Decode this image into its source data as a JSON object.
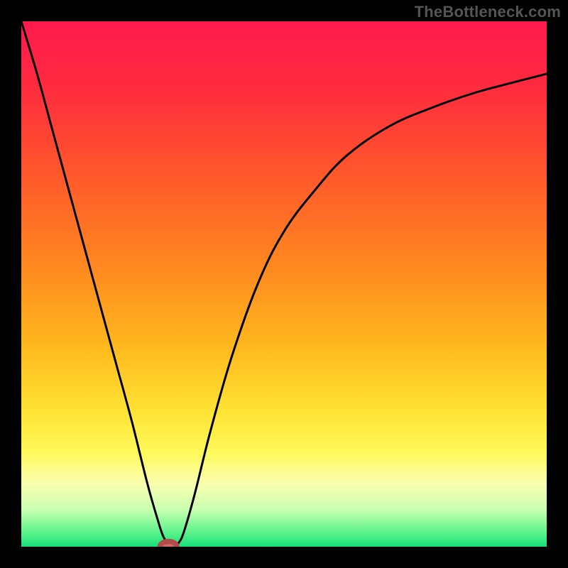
{
  "watermark": "TheBottleneck.com",
  "colors": {
    "black": "#000000",
    "curve": "#000000",
    "marker_fill": "#d46a6a",
    "marker_stroke": "#b24c4c",
    "gradient_stops": [
      {
        "offset": 0.0,
        "color": "#ff1a4d"
      },
      {
        "offset": 0.12,
        "color": "#ff2a3f"
      },
      {
        "offset": 0.3,
        "color": "#ff5a2a"
      },
      {
        "offset": 0.48,
        "color": "#ff8c1f"
      },
      {
        "offset": 0.62,
        "color": "#ffb91e"
      },
      {
        "offset": 0.74,
        "color": "#ffe233"
      },
      {
        "offset": 0.82,
        "color": "#fff95a"
      },
      {
        "offset": 0.88,
        "color": "#faffb0"
      },
      {
        "offset": 0.93,
        "color": "#c8ffb0"
      },
      {
        "offset": 0.97,
        "color": "#63f58e"
      },
      {
        "offset": 1.0,
        "color": "#16e07a"
      }
    ]
  },
  "chart_data": {
    "type": "line",
    "title": "",
    "xlabel": "",
    "ylabel": "",
    "xlim": [
      0,
      100
    ],
    "ylim": [
      0,
      100
    ],
    "grid": false,
    "legend": false,
    "series": [
      {
        "name": "bottleneck-curve",
        "x": [
          0,
          3,
          6,
          9,
          12,
          15,
          18,
          21,
          24,
          26,
          27,
          28,
          29,
          30,
          31,
          33,
          36,
          40,
          45,
          50,
          56,
          62,
          70,
          78,
          86,
          93,
          100
        ],
        "y": [
          100,
          90,
          79,
          68,
          57,
          46,
          35,
          24,
          12,
          5,
          2,
          0.5,
          0,
          0.8,
          3,
          10,
          22,
          36,
          50,
          60,
          68,
          74.5,
          80,
          83.5,
          86.3,
          88.2,
          90
        ]
      }
    ],
    "marker": {
      "x": 28,
      "y": 0,
      "rx": 1.6,
      "ry": 1.0
    }
  }
}
